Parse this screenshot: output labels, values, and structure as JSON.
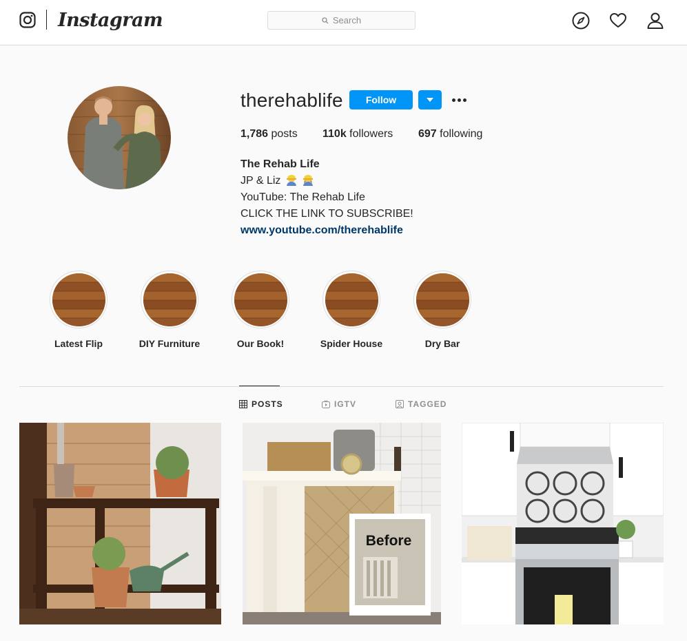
{
  "header": {
    "brand": "Instagram",
    "search_placeholder": "Search",
    "icons": [
      "instagram-glyph-icon",
      "search-icon",
      "compass-icon",
      "heart-icon",
      "profile-icon"
    ]
  },
  "profile": {
    "username": "therehablife",
    "follow_label": "Follow",
    "stats": {
      "posts_count": "1,786",
      "posts_label": "posts",
      "followers_count": "110k",
      "followers_label": "followers",
      "following_count": "697",
      "following_label": "following"
    },
    "bio": {
      "name": "The Rehab Life",
      "line1": "JP & Liz",
      "line2": "YouTube: The Rehab Life",
      "line3": "CLICK THE LINK TO SUBSCRIBE!",
      "link": "www.youtube.com/therehablife"
    }
  },
  "highlights": [
    {
      "label": "Latest Flip"
    },
    {
      "label": "DIY Furniture"
    },
    {
      "label": "Our Book!"
    },
    {
      "label": "Spider House"
    },
    {
      "label": "Dry Bar"
    }
  ],
  "tabs": [
    {
      "label": "POSTS",
      "active": true
    },
    {
      "label": "IGTV",
      "active": false
    },
    {
      "label": "TAGGED",
      "active": false
    }
  ],
  "posts": [
    {
      "overlay_text": ""
    },
    {
      "overlay_text": "Before"
    },
    {
      "overlay_text": ""
    }
  ],
  "colors": {
    "accent": "#0095f6",
    "link": "#00376b",
    "text": "#262626",
    "muted": "#8e8e8e",
    "border": "#dbdbdb"
  }
}
